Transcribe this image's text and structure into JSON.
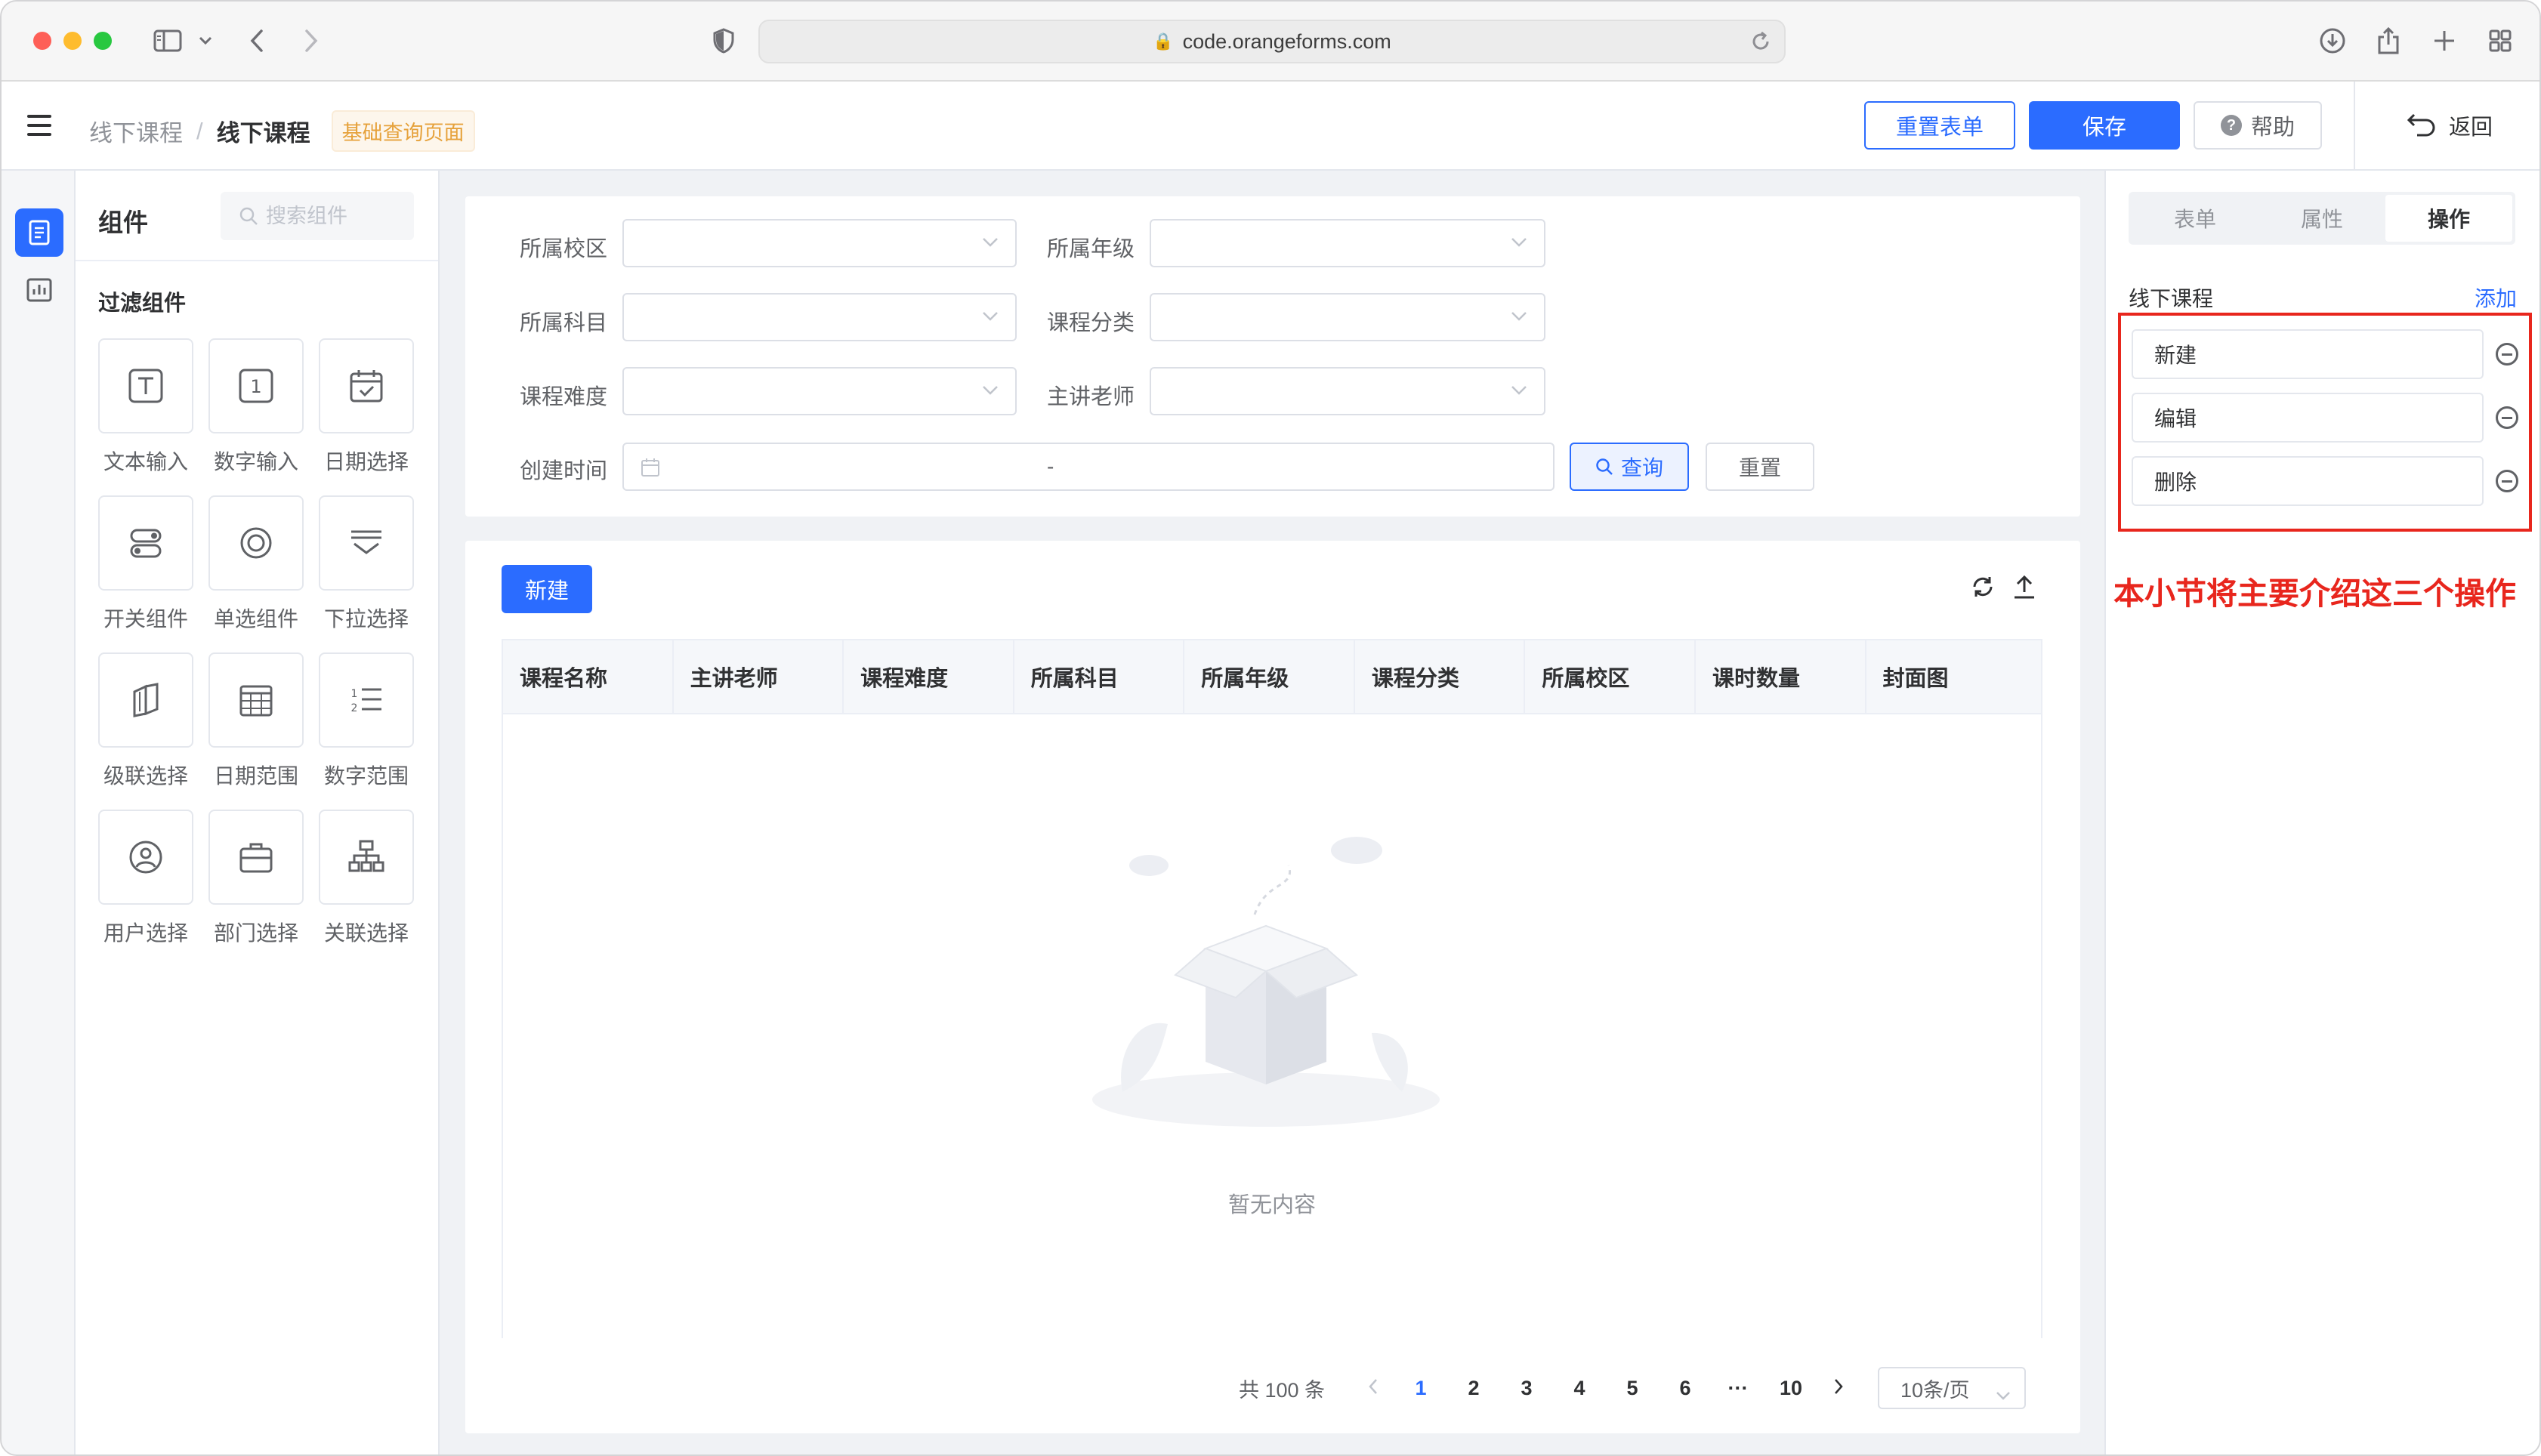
{
  "browser": {
    "url": "code.orangeforms.com"
  },
  "header": {
    "breadcrumb": [
      "线下课程",
      "线下课程"
    ],
    "page_tag": "基础查询页面",
    "reset_form_label": "重置表单",
    "save_label": "保存",
    "help_label": "帮助",
    "back_label": "返回"
  },
  "component_panel": {
    "title": "组件",
    "search_placeholder": "搜索组件",
    "group_title": "过滤组件",
    "items": [
      {
        "label": "文本输入",
        "icon": "text-input-icon"
      },
      {
        "label": "数字输入",
        "icon": "number-input-icon"
      },
      {
        "label": "日期选择",
        "icon": "date-picker-icon"
      },
      {
        "label": "开关组件",
        "icon": "switch-icon"
      },
      {
        "label": "单选组件",
        "icon": "radio-icon"
      },
      {
        "label": "下拉选择",
        "icon": "dropdown-icon"
      },
      {
        "label": "级联选择",
        "icon": "cascader-icon"
      },
      {
        "label": "日期范围",
        "icon": "date-range-icon"
      },
      {
        "label": "数字范围",
        "icon": "number-range-icon"
      },
      {
        "label": "用户选择",
        "icon": "user-select-icon"
      },
      {
        "label": "部门选择",
        "icon": "department-select-icon"
      },
      {
        "label": "关联选择",
        "icon": "relation-select-icon"
      }
    ]
  },
  "filters": {
    "campus_label": "所属校区",
    "grade_label": "所属年级",
    "subject_label": "所属科目",
    "category_label": "课程分类",
    "difficulty_label": "课程难度",
    "teacher_label": "主讲老师",
    "created_label": "创建时间",
    "date_separator": "-",
    "query_label": "查询",
    "reset_label": "重置"
  },
  "table": {
    "new_label": "新建",
    "columns": [
      "课程名称",
      "主讲老师",
      "课程难度",
      "所属科目",
      "所属年级",
      "课程分类",
      "所属校区",
      "课时数量",
      "封面图"
    ],
    "empty_text": "暂无内容"
  },
  "pagination": {
    "total": "共 100 条",
    "pages": [
      "1",
      "2",
      "3",
      "4",
      "5",
      "6",
      "···",
      "10"
    ],
    "current": "1",
    "page_size": "10条/页"
  },
  "right_panel": {
    "tabs": [
      "表单",
      "属性",
      "操作"
    ],
    "active_tab": "操作",
    "operations_title": "线下课程",
    "add_label": "添加",
    "operations": [
      "新建",
      "编辑",
      "删除"
    ],
    "annotation": "本小节将主要介绍这三个操作"
  },
  "colors": {
    "primary": "#2b6cff",
    "annotation_red": "#e8261d",
    "tag_orange": "#e6a23c"
  }
}
